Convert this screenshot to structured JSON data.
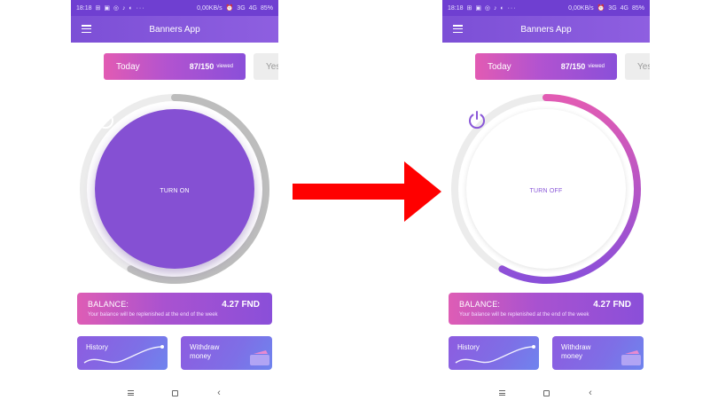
{
  "colors": {
    "status_bar": "#6f3fd1",
    "accent_purple": "#8550d3",
    "accent_pink": "#e25bb3",
    "arrow": "#ff0000"
  },
  "status_bar": {
    "time": "18:18",
    "icons": "⊞ ▣ ◎ ♪ ◐ ···",
    "speed": "0,00KB/s",
    "alarm": "⏰",
    "signal_3g": "3G",
    "signal_4g": "4G",
    "battery": "85%"
  },
  "toolbar": {
    "menu_icon": "hamburger-icon",
    "title": "Banners App"
  },
  "tabs": {
    "today_label": "Today",
    "today_count": "87/150",
    "today_suffix": "viewed",
    "yesterday_label": "Yes"
  },
  "power": {
    "off_state_label": "TURN ON",
    "on_state_label": "TURN OFF",
    "icon": "power-icon"
  },
  "progress": {
    "left_fraction": 0.58,
    "right_fraction": 0.58
  },
  "balance": {
    "title": "BALANCE:",
    "amount": "4.27 FND",
    "note": "Your balance will be replenished at the end of the week"
  },
  "cards": {
    "history_label": "History",
    "withdraw_label_line1": "Withdraw",
    "withdraw_label_line2": "money"
  },
  "nav_bar": {
    "menu_icon": "menu-icon",
    "home_icon": "home-icon",
    "back_icon": "back-icon",
    "back_glyph": "‹"
  }
}
